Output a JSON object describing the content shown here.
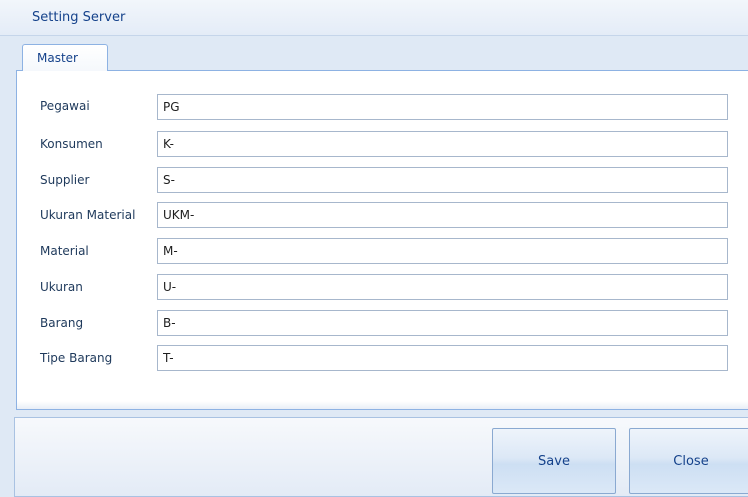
{
  "window": {
    "title": "Setting Server"
  },
  "tabs": [
    {
      "label": "Master",
      "selected": true
    }
  ],
  "form": {
    "rows": [
      {
        "label": "Pegawai",
        "value": "PG"
      },
      {
        "label": "Konsumen",
        "value": "K-"
      },
      {
        "label": "Supplier",
        "value": "S-"
      },
      {
        "label": "Ukuran Material",
        "value": "UKM-"
      },
      {
        "label": "Material",
        "value": "M-"
      },
      {
        "label": "Ukuran",
        "value": "U-"
      },
      {
        "label": "Barang",
        "value": "B-"
      },
      {
        "label": "Tipe Barang",
        "value": "T-"
      }
    ]
  },
  "buttons": {
    "save_label": "Save",
    "close_label": "Close"
  },
  "colors": {
    "title_text": "#15428b",
    "window_bg": "#dfe9f5",
    "border": "#8db2e3"
  }
}
